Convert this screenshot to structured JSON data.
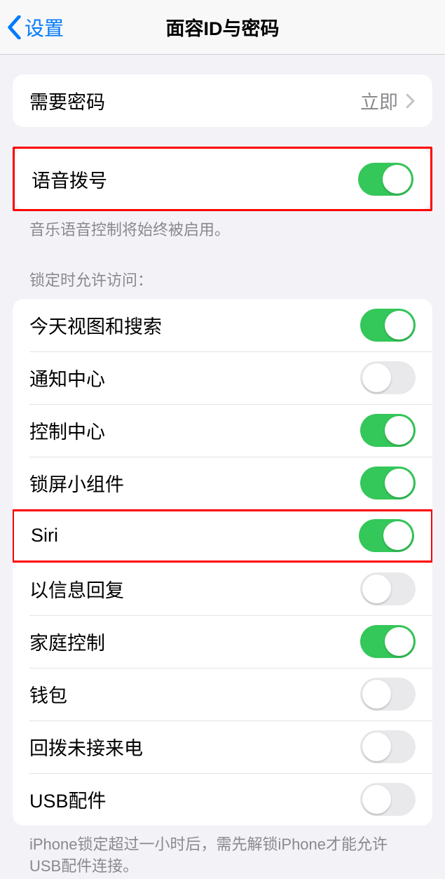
{
  "nav": {
    "back_label": "设置",
    "title": "面容ID与密码"
  },
  "passcode_group": {
    "require_passcode": {
      "label": "需要密码",
      "value": "立即"
    }
  },
  "voice_dial": {
    "label": "语音拨号",
    "enabled": true,
    "footer": "音乐语音控制将始终被启用。"
  },
  "lock_access": {
    "header": "锁定时允许访问：",
    "items": [
      {
        "label": "今天视图和搜索",
        "enabled": true
      },
      {
        "label": "通知中心",
        "enabled": false
      },
      {
        "label": "控制中心",
        "enabled": true
      },
      {
        "label": "锁屏小组件",
        "enabled": true
      },
      {
        "label": "Siri",
        "enabled": true
      },
      {
        "label": "以信息回复",
        "enabled": false
      },
      {
        "label": "家庭控制",
        "enabled": true
      },
      {
        "label": "钱包",
        "enabled": false
      },
      {
        "label": "回拨未接来电",
        "enabled": false
      },
      {
        "label": "USB配件",
        "enabled": false
      }
    ],
    "footer": "iPhone锁定超过一小时后，需先解锁iPhone才能允许USB配件连接。"
  }
}
